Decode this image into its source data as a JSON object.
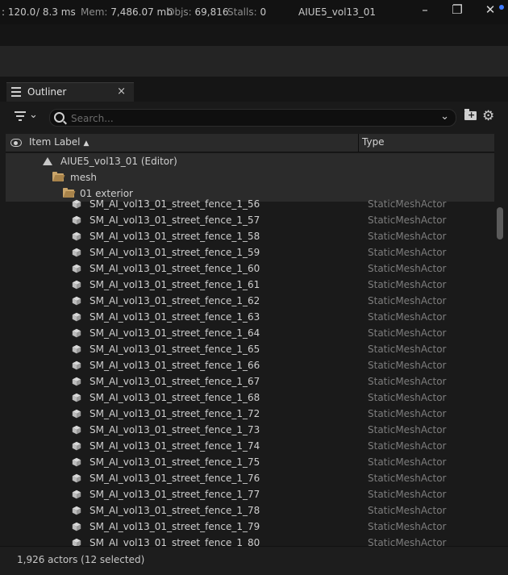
{
  "stats": {
    "fps_label": ":",
    "fps": "120.0",
    "ms": "/ 8.3 ms",
    "mem_label": "Mem:",
    "mem": "7,486.07 mb",
    "objs_label": "Objs:",
    "objs": "69,816",
    "stalls_label": "Stalls:",
    "stalls": "0"
  },
  "window": {
    "title": "AIUE5_vol13_01",
    "minimize": "–",
    "restore": "❐",
    "close": "✕"
  },
  "tab": {
    "label": "Outliner",
    "close": "×"
  },
  "search": {
    "placeholder": "Search...",
    "chevron": "⌄"
  },
  "filter_chevron": "⌄",
  "gear": "⚙",
  "add_folder_glyph": "+",
  "columns": {
    "item_label": "Item Label",
    "sort_arrow": "▲",
    "type": "Type"
  },
  "tree": {
    "level": "AIUE5_vol13_01 (Editor)",
    "folder1": "mesh",
    "folder2": "01 exterior"
  },
  "actors": [
    {
      "name": "SM_AI_vol13_01_street_fence_1_56",
      "type": "StaticMeshActor"
    },
    {
      "name": "SM_AI_vol13_01_street_fence_1_57",
      "type": "StaticMeshActor"
    },
    {
      "name": "SM_AI_vol13_01_street_fence_1_58",
      "type": "StaticMeshActor"
    },
    {
      "name": "SM_AI_vol13_01_street_fence_1_59",
      "type": "StaticMeshActor"
    },
    {
      "name": "SM_AI_vol13_01_street_fence_1_60",
      "type": "StaticMeshActor"
    },
    {
      "name": "SM_AI_vol13_01_street_fence_1_61",
      "type": "StaticMeshActor"
    },
    {
      "name": "SM_AI_vol13_01_street_fence_1_62",
      "type": "StaticMeshActor"
    },
    {
      "name": "SM_AI_vol13_01_street_fence_1_63",
      "type": "StaticMeshActor"
    },
    {
      "name": "SM_AI_vol13_01_street_fence_1_64",
      "type": "StaticMeshActor"
    },
    {
      "name": "SM_AI_vol13_01_street_fence_1_65",
      "type": "StaticMeshActor"
    },
    {
      "name": "SM_AI_vol13_01_street_fence_1_66",
      "type": "StaticMeshActor"
    },
    {
      "name": "SM_AI_vol13_01_street_fence_1_67",
      "type": "StaticMeshActor"
    },
    {
      "name": "SM_AI_vol13_01_street_fence_1_68",
      "type": "StaticMeshActor"
    },
    {
      "name": "SM_AI_vol13_01_street_fence_1_72",
      "type": "StaticMeshActor"
    },
    {
      "name": "SM_AI_vol13_01_street_fence_1_73",
      "type": "StaticMeshActor"
    },
    {
      "name": "SM_AI_vol13_01_street_fence_1_74",
      "type": "StaticMeshActor"
    },
    {
      "name": "SM_AI_vol13_01_street_fence_1_75",
      "type": "StaticMeshActor"
    },
    {
      "name": "SM_AI_vol13_01_street_fence_1_76",
      "type": "StaticMeshActor"
    },
    {
      "name": "SM_AI_vol13_01_street_fence_1_77",
      "type": "StaticMeshActor"
    },
    {
      "name": "SM_AI_vol13_01_street_fence_1_78",
      "type": "StaticMeshActor"
    },
    {
      "name": "SM_AI_vol13_01_street_fence_1_79",
      "type": "StaticMeshActor"
    },
    {
      "name": "SM_AI_vol13_01_street_fence_1_80",
      "type": "StaticMeshActor"
    }
  ],
  "footer": {
    "status": "1,926 actors (12 selected)"
  },
  "colors": {
    "folder": "#caa56a",
    "notification": "#3f7bff"
  }
}
